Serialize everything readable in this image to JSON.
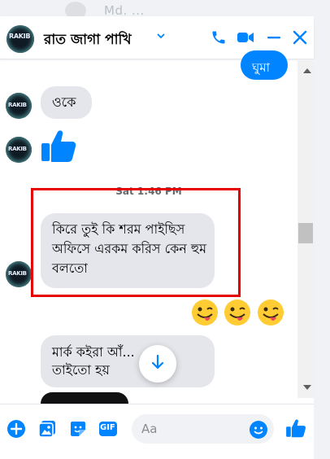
{
  "header": {
    "title": "রাত জাগা পাখি",
    "avatar_text": "RAKIB"
  },
  "background_chat": {
    "ghost_name": "Md. ..."
  },
  "messages": {
    "outgoing_top": "ঘুমা",
    "incoming_1": "ওকে",
    "timestamp": "Sat 1:46 PM",
    "incoming_2": "কিরে তুই কি শরম পাইছিস অফিসে এরকম করিস কেন হুম বলতো",
    "incoming_3": "মার্ক কইরা আঁ... তাইতো হয়"
  },
  "footer": {
    "input_placeholder": "Aa",
    "gif_label": "GIF"
  },
  "colors": {
    "accent": "#0084ff",
    "bubble_in": "#e4e6eb",
    "highlight_border": "#e60000"
  },
  "icons": [
    "chevron-down-icon",
    "phone-icon",
    "video-icon",
    "minimize-icon",
    "close-icon",
    "like-thumb-icon",
    "add-icon",
    "image-icon",
    "sticker-icon",
    "gif-icon",
    "emoji-icon",
    "scroll-down-arrow-icon"
  ]
}
